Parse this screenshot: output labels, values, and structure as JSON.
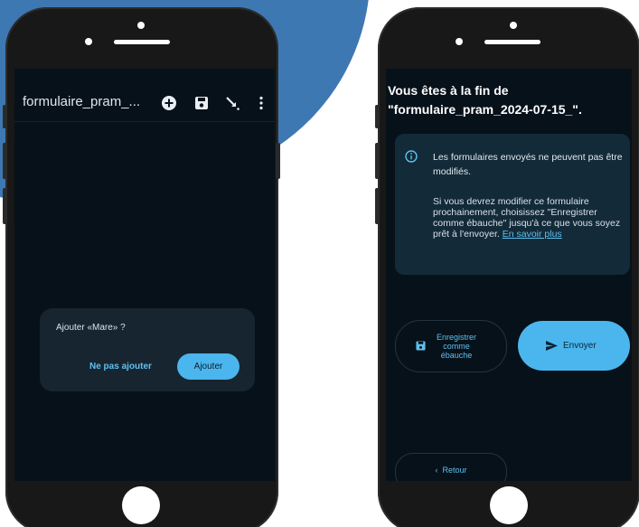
{
  "left_screen": {
    "toolbar": {
      "title": "formulaire_pram_...",
      "icons": [
        "add-circle-icon",
        "save-icon",
        "edit-arrow-icon",
        "more-vertical-icon"
      ]
    },
    "dialog": {
      "message": "Ajouter «Mare» ?",
      "decline_label": "Ne pas ajouter",
      "confirm_label": "Ajouter"
    }
  },
  "right_screen": {
    "end_title": "Vous êtes à la fin de \"formulaire_pram_2024-07-15_\".",
    "info": {
      "icon": "info-icon",
      "primary_text": "Les formulaires envoyés ne peuvent pas être modifiés.",
      "secondary_text": "Si vous devrez modifier ce formulaire prochainement, choisissez \"Enregistrer comme ébauche\" jusqu'à ce que vous soyez prêt à l'envoyer.",
      "learn_more": "En savoir plus"
    },
    "draft_button": {
      "label": "Enregistrer comme ébauche",
      "icon": "save-icon"
    },
    "send_button": {
      "label": "Envoyer",
      "icon": "send-icon"
    },
    "back_button": {
      "label": "Retour",
      "icon": "chevron-left-icon"
    }
  },
  "colors": {
    "background_accent": "#3e78b2",
    "screen_bg": "#07111a",
    "card_bg": "#132a38",
    "primary": "#4bb6ee",
    "link": "#5fc0f0"
  }
}
